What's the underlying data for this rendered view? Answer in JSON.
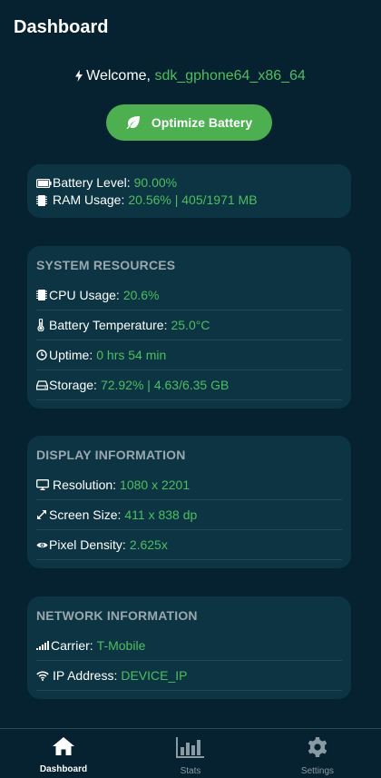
{
  "header": {
    "title": "Dashboard"
  },
  "welcome": {
    "prefix": "Welcome,",
    "device": "sdk_gphone64_x86_64"
  },
  "optimize_button": {
    "label": "Optimize Battery"
  },
  "summary": {
    "battery_label": "Battery Level:",
    "battery_value": "90.00%",
    "ram_label": "RAM Usage:",
    "ram_value": "20.56% | 405/1971 MB"
  },
  "system_resources": {
    "title": "SYSTEM RESOURCES",
    "rows": [
      {
        "icon": "cpu-icon",
        "label": "CPU Usage:",
        "value": "20.6%"
      },
      {
        "icon": "thermometer-icon",
        "label": "Battery Temperature:",
        "value": "25.0°C"
      },
      {
        "icon": "clock-icon",
        "label": "Uptime:",
        "value": "0 hrs 54 min"
      },
      {
        "icon": "hdd-icon",
        "label": "Storage:",
        "value": "72.92% | 4.63/6.35 GB"
      }
    ]
  },
  "display_information": {
    "title": "DISPLAY INFORMATION",
    "rows": [
      {
        "icon": "monitor-icon",
        "label": "Resolution:",
        "value": "1080 x 2201"
      },
      {
        "icon": "expand-icon",
        "label": "Screen Size:",
        "value": "411 x 838 dp"
      },
      {
        "icon": "eye-icon",
        "label": "Pixel Density:",
        "value": "2.625x"
      }
    ]
  },
  "network_information": {
    "title": "NETWORK INFORMATION",
    "rows": [
      {
        "icon": "signal-icon",
        "label": "Carrier:",
        "value": "T-Mobile"
      },
      {
        "icon": "wifi-icon",
        "label": "IP Address:",
        "value": "DEVICE_IP"
      }
    ]
  },
  "bottom_nav": {
    "items": [
      {
        "label": "Dashboard",
        "icon": "home-icon",
        "active": true
      },
      {
        "label": "Stats",
        "icon": "bar-chart-icon",
        "active": false
      },
      {
        "label": "Settings",
        "icon": "gear-icon",
        "active": false
      }
    ]
  },
  "colors": {
    "background": "#06212f",
    "card": "#0c3443",
    "accent": "#4cbf5f",
    "button": "#4caf50",
    "section_title": "#9aa7ae"
  }
}
